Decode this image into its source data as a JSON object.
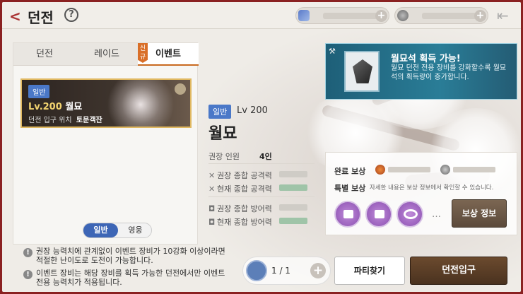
{
  "header": {
    "back_icon": "chevron-left-icon",
    "title": "던전",
    "help": "?"
  },
  "currency": [
    {
      "plus": "+"
    },
    {
      "plus": "+"
    }
  ],
  "tabs": [
    {
      "label": "던전"
    },
    {
      "label": "레이드"
    },
    {
      "label": "이벤트",
      "badge": "신규"
    }
  ],
  "dungeon_card": {
    "tag": "일반",
    "level": "Lv.200",
    "name": "월묘",
    "location_label": "던전 입구 위치",
    "location": "토문객잔"
  },
  "mode_toggle": {
    "normal": "일반",
    "hero": "영웅"
  },
  "info": {
    "tag": "일반",
    "level": "Lv 200",
    "name": "월묘",
    "party_label": "권장 인원",
    "party_value": "4인",
    "rows": [
      {
        "label": "권장 종합 공격력"
      },
      {
        "label": "현재 종합 공격력"
      },
      {
        "label": "권장 종합 방어력"
      },
      {
        "label": "현재 종합 방어력"
      }
    ]
  },
  "banner": {
    "title": "월묘석 획득 가능!",
    "desc": "월묘 던전 전용 장비를 강화할수록 월묘석의 획득량이 증가합니다."
  },
  "reward": {
    "complete_label": "완료 보상",
    "special_label": "특별 보상",
    "special_desc": "자세한 내용은 보상 정보에서 확인할 수 있습니다.",
    "more": "…",
    "info_button": "보상 정보"
  },
  "notes": [
    "권장 능력치에 관계없이 이벤트 장비가 10강화 이상이라면 적절한 난이도로 도전이 가능합니다.",
    "이벤트 장비는 해당 장비를 획득 가능한 던전에서만 이벤트 전용 능력치가 적용됩니다."
  ],
  "tickets": {
    "count": "1 / 1",
    "plus": "+"
  },
  "buttons": {
    "party": "파티찾기",
    "enter": "던전입구"
  },
  "colors": {
    "accent": "#3d66b6",
    "brand": "#8a2121",
    "level": "#f2d36f"
  }
}
